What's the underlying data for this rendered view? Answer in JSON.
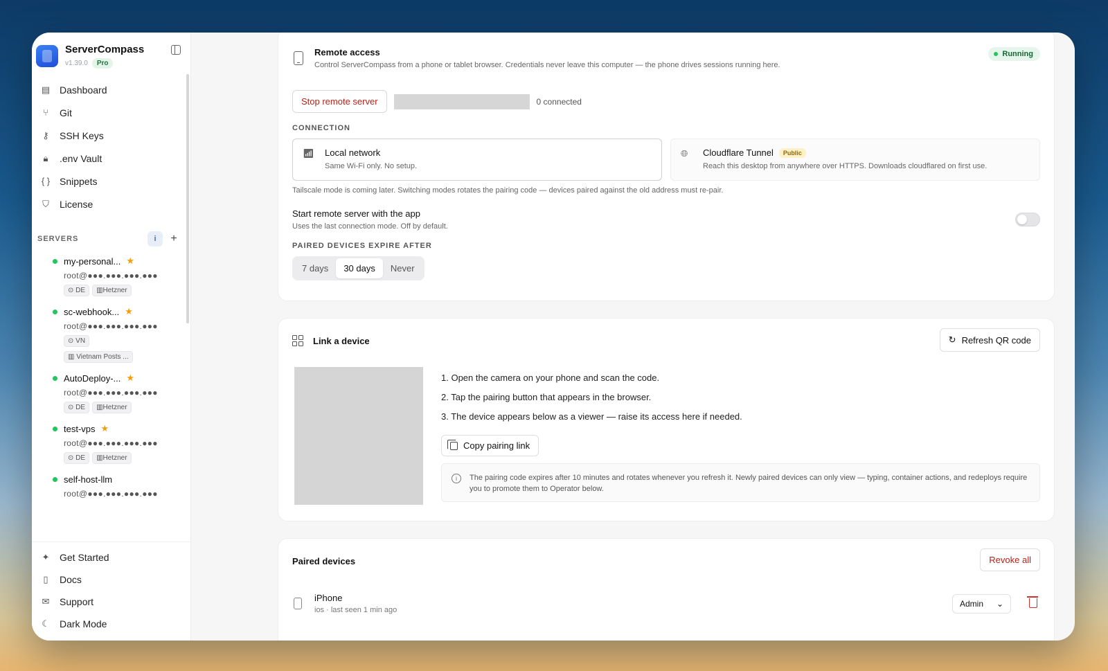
{
  "app": {
    "name": "ServerCompass",
    "version": "v1.39.0",
    "plan": "Pro"
  },
  "nav": [
    {
      "label": "Dashboard",
      "icon": "server-stack-icon"
    },
    {
      "label": "Git",
      "icon": "git-branch-icon"
    },
    {
      "label": "SSH Keys",
      "icon": "key-icon"
    },
    {
      "label": ".env Vault",
      "icon": "lock-icon"
    },
    {
      "label": "Snippets",
      "icon": "braces-icon"
    },
    {
      "label": "License",
      "icon": "shield-icon"
    }
  ],
  "servers": {
    "title": "SERVERS",
    "items": [
      {
        "name": "my-personal...",
        "host": "root@●●●.●●●.●●●.●●●",
        "tags": [
          "DE",
          "Hetzner"
        ],
        "starred": true
      },
      {
        "name": "sc-webhook...",
        "host": "root@●●●.●●●.●●●.●●●",
        "tags": [
          "VN",
          "Vietnam Posts ..."
        ],
        "starred": true
      },
      {
        "name": "AutoDeploy-...",
        "host": "root@●●●.●●●.●●●.●●●",
        "tags": [
          "DE",
          "Hetzner"
        ],
        "starred": true
      },
      {
        "name": "test-vps",
        "host": "root@●●●.●●●.●●●.●●●",
        "tags": [
          "DE",
          "Hetzner"
        ],
        "starred": true
      },
      {
        "name": "self-host-llm",
        "host": "root@●●●.●●●.●●●.●●●",
        "tags": [],
        "starred": false
      }
    ]
  },
  "bottom_nav": [
    {
      "label": "Get Started",
      "icon": "sparkles-icon"
    },
    {
      "label": "Docs",
      "icon": "book-icon"
    },
    {
      "label": "Support",
      "icon": "mail-icon"
    },
    {
      "label": "Dark Mode",
      "icon": "moon-icon"
    }
  ],
  "remote_access": {
    "title": "Remote access",
    "description": "Control ServerCompass from a phone or tablet browser. Credentials never leave this computer — the phone drives sessions running here.",
    "status": "Running",
    "stop_label": "Stop remote server",
    "connected_text": "0 connected",
    "connection_label": "CONNECTION",
    "local": {
      "title": "Local network",
      "description": "Same Wi-Fi only. No setup."
    },
    "cloudflare": {
      "title": "Cloudflare Tunnel",
      "badge": "Public",
      "description": "Reach this desktop from anywhere over HTTPS. Downloads cloudflared on first use."
    },
    "hint": "Tailscale mode is coming later. Switching modes rotates the pairing code — devices paired against the old address must re-pair.",
    "start_title": "Start remote server with the app",
    "start_description": "Uses the last connection mode. Off by default.",
    "start_enabled": false,
    "expire_label": "PAIRED DEVICES EXPIRE AFTER",
    "expire_options": [
      "7 days",
      "30 days",
      "Never"
    ],
    "expire_selected": "30 days"
  },
  "link_device": {
    "title": "Link a device",
    "refresh_label": "Refresh QR code",
    "steps": [
      "1. Open the camera on your phone and scan the code.",
      "2. Tap the pairing button that appears in the browser.",
      "3. The device appears below as a viewer — raise its access here if needed."
    ],
    "copy_label": "Copy pairing link",
    "notice": "The pairing code expires after 10 minutes and rotates whenever you refresh it. Newly paired devices can only view — typing, container actions, and redeploys require you to promote them to Operator below."
  },
  "paired_devices": {
    "title": "Paired devices",
    "revoke_label": "Revoke all",
    "devices": [
      {
        "name": "iPhone",
        "meta": "ios · last seen 1 min ago",
        "role": "Admin"
      }
    ]
  },
  "colors": {
    "accent": "#2563eb",
    "danger": "#b42318",
    "success": "#22c55e",
    "star": "#f59e0b"
  }
}
